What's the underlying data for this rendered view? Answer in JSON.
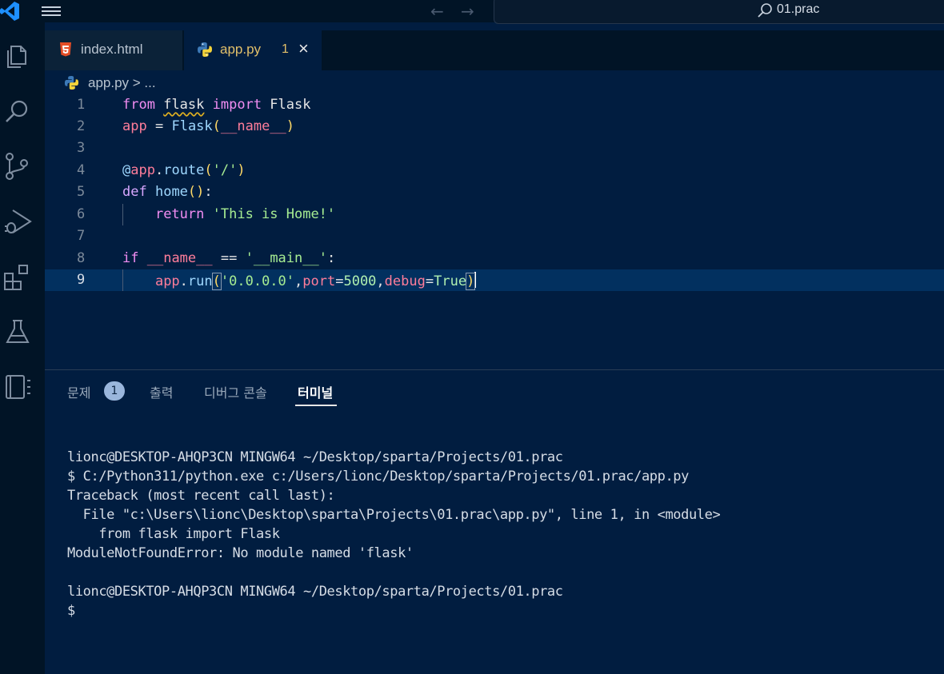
{
  "titlebar": {
    "search_text": "01.prac",
    "back_arrow": "←",
    "forward_arrow": "→"
  },
  "activity_icons": [
    "explorer-icon",
    "search-icon",
    "source-control-icon",
    "run-debug-icon",
    "extensions-icon",
    "testing-icon",
    "notebook-icon"
  ],
  "tabs": [
    {
      "label": "index.html",
      "icon": "html5-icon",
      "active": false
    },
    {
      "label": "app.py",
      "icon": "python-icon",
      "active": true,
      "problems": "1",
      "close": "×"
    }
  ],
  "breadcrumb": {
    "file": "app.py",
    "separator": " > ",
    "rest": "..."
  },
  "editor": {
    "lines": [
      {
        "n": "1",
        "t": "from flask import Flask"
      },
      {
        "n": "2",
        "t": "app = Flask(__name__)"
      },
      {
        "n": "3",
        "t": ""
      },
      {
        "n": "4",
        "t": "@app.route('/')"
      },
      {
        "n": "5",
        "t": "def home():"
      },
      {
        "n": "6",
        "t": "    return 'This is Home!'"
      },
      {
        "n": "7",
        "t": ""
      },
      {
        "n": "8",
        "t": "if __name__ == '__main__':"
      },
      {
        "n": "9",
        "t": "    app.run('0.0.0.0',port=5000,debug=True)"
      }
    ]
  },
  "panel": {
    "tabs": [
      {
        "label": "문제",
        "badge": "1"
      },
      {
        "label": "출력"
      },
      {
        "label": "디버그 콘솔"
      },
      {
        "label": "터미널",
        "active": true
      }
    ]
  },
  "terminal": {
    "lines": [
      "lionc@DESKTOP-AHQP3CN MINGW64 ~/Desktop/sparta/Projects/01.prac",
      "$ C:/Python311/python.exe c:/Users/lionc/Desktop/sparta/Projects/01.prac/app.py",
      "Traceback (most recent call last):",
      "  File \"c:\\Users\\lionc\\Desktop\\sparta\\Projects\\01.prac\\app.py\", line 1, in <module>",
      "    from flask import Flask",
      "ModuleNotFoundError: No module named 'flask'",
      "",
      "lionc@DESKTOP-AHQP3CN MINGW64 ~/Desktop/sparta/Projects/01.prac",
      "$"
    ]
  },
  "colors": {
    "accent": "#1e90ff",
    "editor_bg": "#011d40",
    "chrome_bg": "#011426",
    "active_line": "#02305f",
    "tab_active_text": "#e2c06a"
  }
}
